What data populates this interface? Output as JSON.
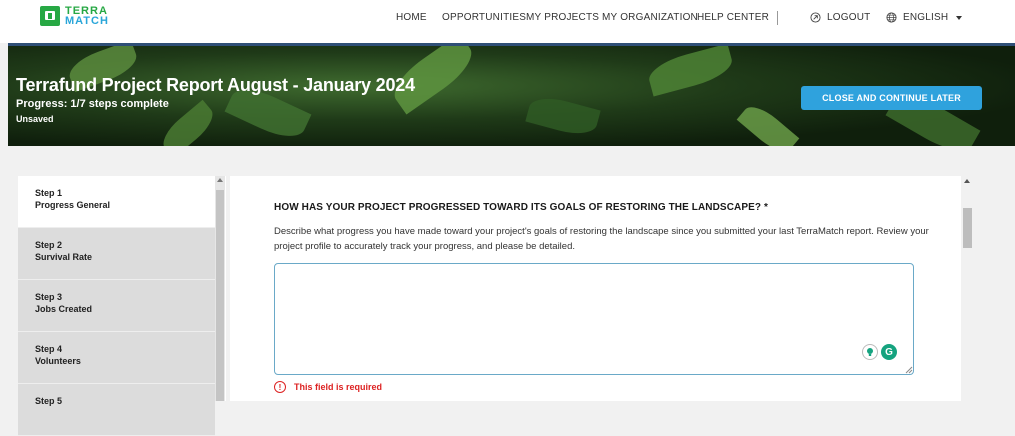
{
  "brand": {
    "line1": "TERRA",
    "line2": "MATCH"
  },
  "nav": {
    "items": [
      "HOME",
      "OPPORTUNITIES",
      "MY PROJECTS",
      "MY ORGANIZATION",
      "HELP CENTER"
    ],
    "logout": "LOGOUT",
    "language": "ENGLISH",
    "icons": {
      "logout": "logout-icon",
      "language": "globe-icon",
      "dropdown": "caret-down-icon"
    }
  },
  "banner": {
    "title": "Terrafund Project Report August - January 2024",
    "progress": "Progress: 1/7 steps complete",
    "save_status": "Unsaved",
    "close_label": "CLOSE AND CONTINUE LATER"
  },
  "steps": [
    {
      "num": "Step 1",
      "name": "Progress General",
      "active": true
    },
    {
      "num": "Step 2",
      "name": "Survival Rate",
      "active": false
    },
    {
      "num": "Step 3",
      "name": "Jobs Created",
      "active": false
    },
    {
      "num": "Step 4",
      "name": "Volunteers",
      "active": false
    },
    {
      "num": "Step 5",
      "name": "",
      "active": false
    }
  ],
  "form": {
    "question": "HOW HAS YOUR PROJECT PROGRESSED TOWARD ITS GOALS OF RESTORING THE LANDSCAPE? *",
    "description": "Describe what progress you have made toward your project's goals of restoring the landscape since you submitted your last TerraMatch report. Review your project profile to accurately track your progress, and please be detailed.",
    "value": "",
    "error": "This field is required"
  },
  "colors": {
    "accent": "#2fa2dd",
    "brand_green": "#27a844",
    "error": "#dd2222"
  }
}
